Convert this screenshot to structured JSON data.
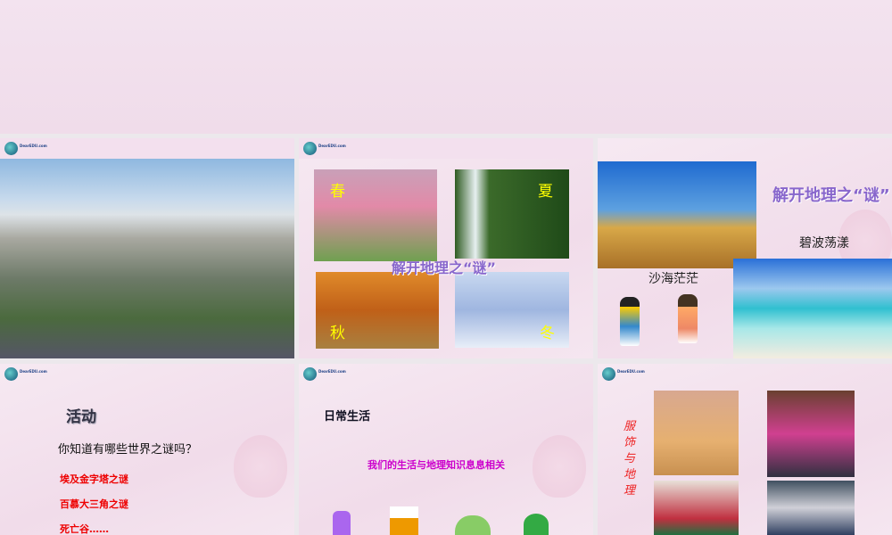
{
  "logo": "DearEDU.com",
  "slide2": {
    "spring": "春",
    "summer": "夏",
    "autumn": "秋",
    "winter": "冬",
    "title": "解开地理之“谜”"
  },
  "slide3": {
    "title": "解开地理之“谜”",
    "sea": "碧波荡漾",
    "desert": "沙海茫茫"
  },
  "slide4": {
    "title": "活动",
    "question": "你知道有哪些世界之谜吗？",
    "items": [
      "埃及金字塔之谜",
      "百慕大三角之谜",
      "死亡谷……"
    ]
  },
  "slide5": {
    "title": "日常生活",
    "subtitle": "我们的生活与地理知识息息相关"
  },
  "slide6": {
    "vertical_title": "服饰与地理"
  }
}
